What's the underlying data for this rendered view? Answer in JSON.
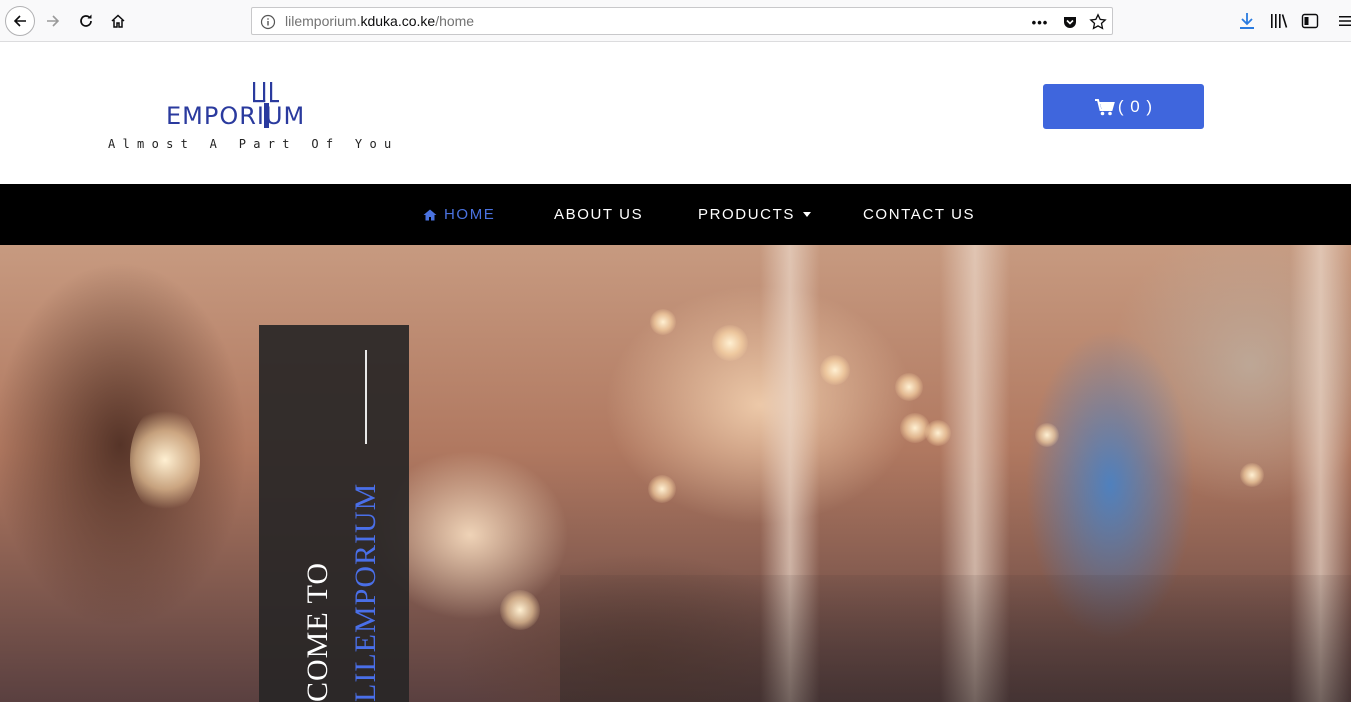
{
  "browser": {
    "url_prefix": "lilemporium.",
    "url_host": "kduka.co.ke",
    "url_path": "/home",
    "page_actions_label": "•••"
  },
  "header": {
    "logo_word": "EMPORIUM",
    "logo_tagline": "Almost A Part Of You",
    "cart_label": "( 0 )"
  },
  "nav": {
    "items": [
      {
        "label": "HOME",
        "active": true
      },
      {
        "label": "ABOUT US",
        "active": false
      },
      {
        "label": "PRODUCTS",
        "active": false
      },
      {
        "label": "CONTACT US",
        "active": false
      }
    ]
  },
  "hero": {
    "welcome_text": "COME TO",
    "brand_text": "LILEMPORIUM"
  },
  "colors": {
    "accent": "#3f66dd",
    "nav_background": "#000000",
    "nav_active": "#4a72e0",
    "logo_blue": "#2a3a9e"
  },
  "icons": {
    "back": "back-arrow-icon",
    "forward": "forward-arrow-icon",
    "reload": "reload-icon",
    "home": "home-icon",
    "site_info": "info-icon",
    "pocket": "pocket-icon",
    "bookmark": "star-icon",
    "download": "download-icon",
    "library": "library-icon",
    "sidebar": "sidebar-icon",
    "menu": "hamburger-menu-icon",
    "cart": "shopping-cart-icon"
  }
}
